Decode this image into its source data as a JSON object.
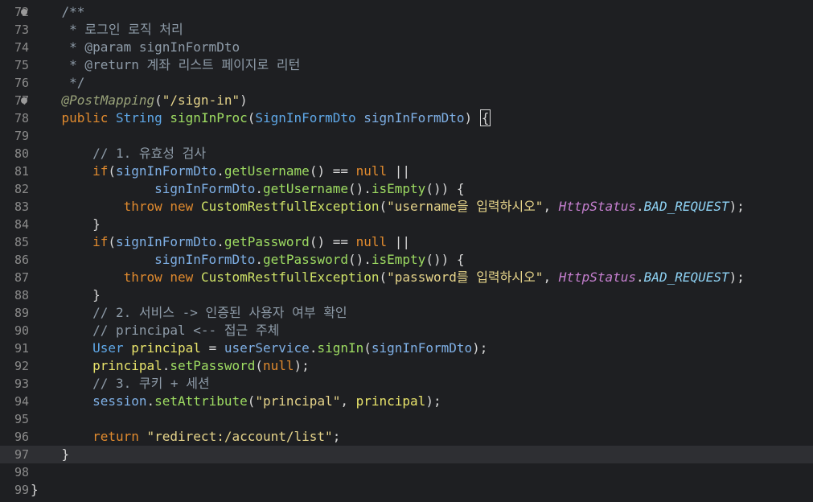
{
  "editor": {
    "language": "java",
    "current_line": 97,
    "lines": [
      {
        "n": "72",
        "fold": true,
        "tokens": [
          [
            "cm",
            "    /**"
          ]
        ]
      },
      {
        "n": "73",
        "tokens": [
          [
            "cm",
            "     * 로그인 로직 처리"
          ]
        ]
      },
      {
        "n": "74",
        "tokens": [
          [
            "cm",
            "     * @param signInFormDto"
          ]
        ]
      },
      {
        "n": "75",
        "tokens": [
          [
            "cm",
            "     * @return 계좌 리스트 페이지로 리턴"
          ]
        ]
      },
      {
        "n": "76",
        "tokens": [
          [
            "cm",
            "     */"
          ]
        ]
      },
      {
        "n": "77",
        "fold": true,
        "tokens": [
          [
            "pu",
            "    "
          ],
          [
            "an",
            "@PostMapping"
          ],
          [
            "pu",
            "("
          ],
          [
            "st",
            "\"/sign-in\""
          ],
          [
            "pu",
            ")"
          ]
        ]
      },
      {
        "n": "78",
        "tokens": [
          [
            "pu",
            "    "
          ],
          [
            "kw",
            "public"
          ],
          [
            "pu",
            " "
          ],
          [
            "ty",
            "String"
          ],
          [
            "pu",
            " "
          ],
          [
            "fn",
            "signInProc"
          ],
          [
            "pu",
            "("
          ],
          [
            "ty",
            "SignInFormDto"
          ],
          [
            "pu",
            " "
          ],
          [
            "vr",
            "signInFormDto"
          ],
          [
            "pu",
            ") "
          ],
          [
            "caret",
            "{"
          ]
        ]
      },
      {
        "n": "79",
        "tokens": []
      },
      {
        "n": "80",
        "tokens": [
          [
            "cm",
            "        // 1. 유효성 검사"
          ]
        ]
      },
      {
        "n": "81",
        "tokens": [
          [
            "pu",
            "        "
          ],
          [
            "kw",
            "if"
          ],
          [
            "pu",
            "("
          ],
          [
            "vr",
            "signInFormDto"
          ],
          [
            "pu",
            "."
          ],
          [
            "fn",
            "getUsername"
          ],
          [
            "pu",
            "() == "
          ],
          [
            "kw",
            "null"
          ],
          [
            "pu",
            " ||"
          ]
        ]
      },
      {
        "n": "82",
        "tokens": [
          [
            "pu",
            "                "
          ],
          [
            "vr",
            "signInFormDto"
          ],
          [
            "pu",
            "."
          ],
          [
            "fn",
            "getUsername"
          ],
          [
            "pu",
            "()."
          ],
          [
            "fn",
            "isEmpty"
          ],
          [
            "pu",
            "()) {"
          ]
        ]
      },
      {
        "n": "83",
        "tokens": [
          [
            "pu",
            "            "
          ],
          [
            "kw",
            "throw"
          ],
          [
            "pu",
            " "
          ],
          [
            "kw",
            "new"
          ],
          [
            "pu",
            " "
          ],
          [
            "cls",
            "CustomRestfullException"
          ],
          [
            "pu",
            "("
          ],
          [
            "st",
            "\"username을 입력하시오\""
          ],
          [
            "pu",
            ", "
          ],
          [
            "hs",
            "HttpStatus"
          ],
          [
            "pu",
            "."
          ],
          [
            "cn",
            "BAD_REQUEST"
          ],
          [
            "pu",
            ");"
          ]
        ]
      },
      {
        "n": "84",
        "tokens": [
          [
            "pu",
            "        }"
          ]
        ]
      },
      {
        "n": "85",
        "tokens": [
          [
            "pu",
            "        "
          ],
          [
            "kw",
            "if"
          ],
          [
            "pu",
            "("
          ],
          [
            "vr",
            "signInFormDto"
          ],
          [
            "pu",
            "."
          ],
          [
            "fn",
            "getPassword"
          ],
          [
            "pu",
            "() == "
          ],
          [
            "kw",
            "null"
          ],
          [
            "pu",
            " ||"
          ]
        ]
      },
      {
        "n": "86",
        "tokens": [
          [
            "pu",
            "                "
          ],
          [
            "vr",
            "signInFormDto"
          ],
          [
            "pu",
            "."
          ],
          [
            "fn",
            "getPassword"
          ],
          [
            "pu",
            "()."
          ],
          [
            "fn",
            "isEmpty"
          ],
          [
            "pu",
            "()) {"
          ]
        ]
      },
      {
        "n": "87",
        "tokens": [
          [
            "pu",
            "            "
          ],
          [
            "kw",
            "throw"
          ],
          [
            "pu",
            " "
          ],
          [
            "kw",
            "new"
          ],
          [
            "pu",
            " "
          ],
          [
            "cls",
            "CustomRestfullException"
          ],
          [
            "pu",
            "("
          ],
          [
            "st",
            "\"password를 입력하시오\""
          ],
          [
            "pu",
            ", "
          ],
          [
            "hs",
            "HttpStatus"
          ],
          [
            "pu",
            "."
          ],
          [
            "cn",
            "BAD_REQUEST"
          ],
          [
            "pu",
            ");"
          ]
        ]
      },
      {
        "n": "88",
        "tokens": [
          [
            "pu",
            "        }"
          ]
        ]
      },
      {
        "n": "89",
        "tokens": [
          [
            "cm",
            "        // 2. 서비스 -> 인증된 사용자 여부 확인"
          ]
        ]
      },
      {
        "n": "90",
        "tokens": [
          [
            "cm",
            "        // principal <-- 접근 주체"
          ]
        ]
      },
      {
        "n": "91",
        "tokens": [
          [
            "pu",
            "        "
          ],
          [
            "ty",
            "User"
          ],
          [
            "pu",
            " "
          ],
          [
            "lp",
            "principal"
          ],
          [
            "pu",
            " = "
          ],
          [
            "vr",
            "userService"
          ],
          [
            "pu",
            "."
          ],
          [
            "fn",
            "signIn"
          ],
          [
            "pu",
            "("
          ],
          [
            "vr",
            "signInFormDto"
          ],
          [
            "pu",
            ");"
          ]
        ]
      },
      {
        "n": "92",
        "tokens": [
          [
            "pu",
            "        "
          ],
          [
            "lp",
            "principal"
          ],
          [
            "pu",
            "."
          ],
          [
            "fn",
            "setPassword"
          ],
          [
            "pu",
            "("
          ],
          [
            "kw",
            "null"
          ],
          [
            "pu",
            ");"
          ]
        ]
      },
      {
        "n": "93",
        "tokens": [
          [
            "cm",
            "        // 3. 쿠키 + 세션"
          ]
        ]
      },
      {
        "n": "94",
        "tokens": [
          [
            "pu",
            "        "
          ],
          [
            "vr",
            "session"
          ],
          [
            "pu",
            "."
          ],
          [
            "fn",
            "setAttribute"
          ],
          [
            "pu",
            "("
          ],
          [
            "st",
            "\"principal\""
          ],
          [
            "pu",
            ", "
          ],
          [
            "lp",
            "principal"
          ],
          [
            "pu",
            ");"
          ]
        ]
      },
      {
        "n": "95",
        "tokens": []
      },
      {
        "n": "96",
        "tokens": [
          [
            "pu",
            "        "
          ],
          [
            "kw",
            "return"
          ],
          [
            "pu",
            " "
          ],
          [
            "st",
            "\"redirect:/account/list\""
          ],
          [
            "pu",
            ";"
          ]
        ]
      },
      {
        "n": "97",
        "tokens": [
          [
            "pu",
            "    }"
          ]
        ]
      },
      {
        "n": "98",
        "tokens": []
      },
      {
        "n": "99",
        "tokens": [
          [
            "pu",
            "}"
          ]
        ]
      }
    ]
  }
}
